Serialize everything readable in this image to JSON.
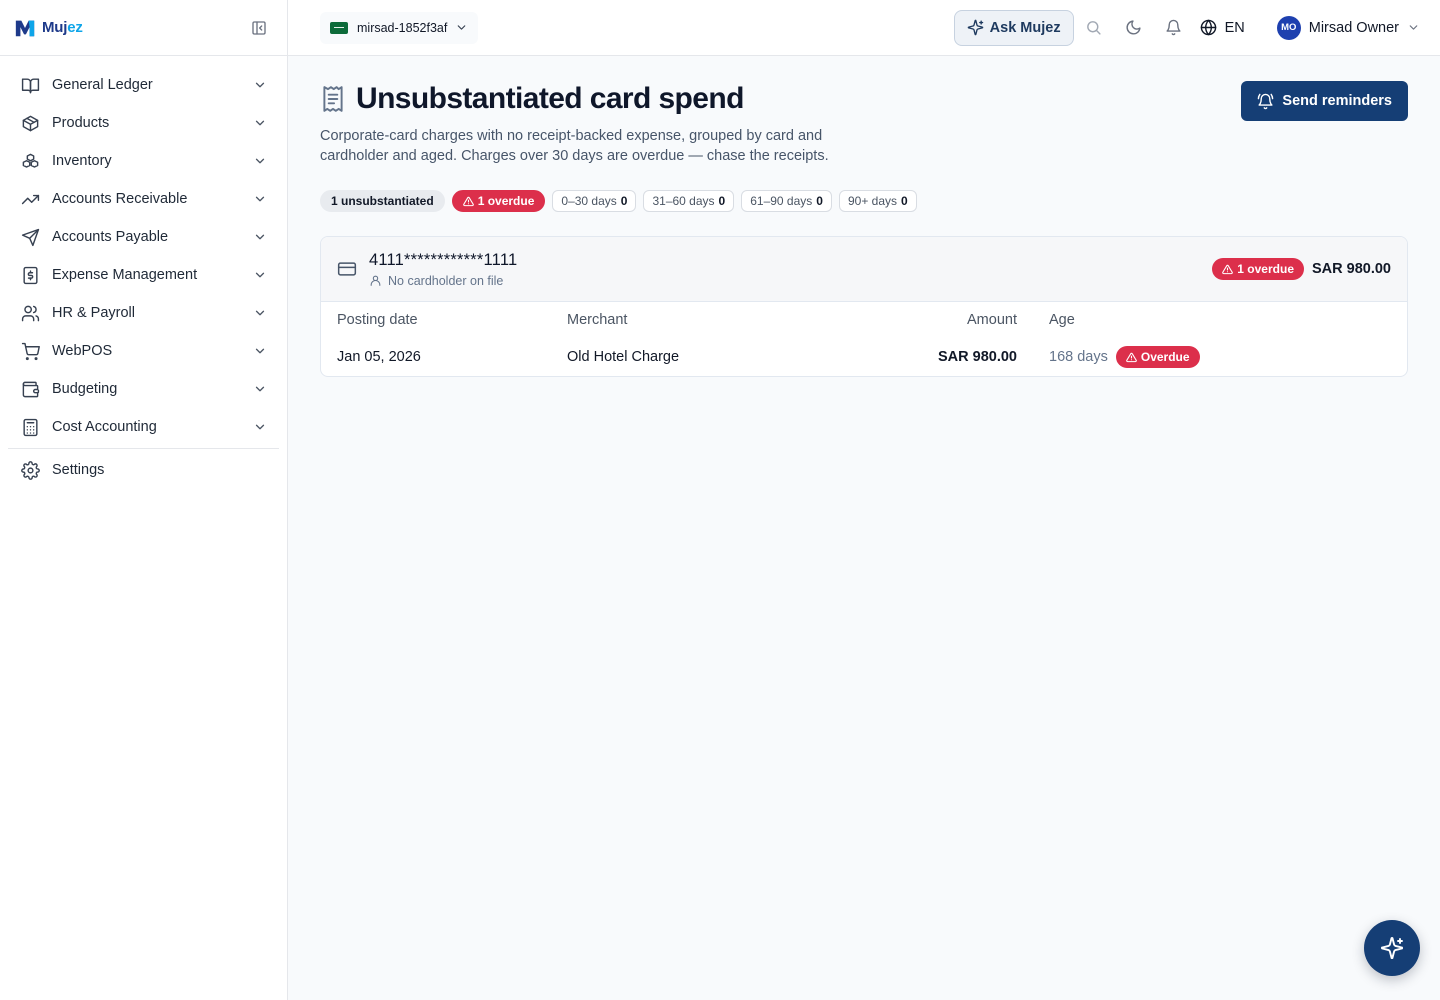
{
  "brand": {
    "name_main": "Muj",
    "name_accent": "ez"
  },
  "sidebar": {
    "items": [
      {
        "label": "General Ledger",
        "icon": "book-open-icon"
      },
      {
        "label": "Products",
        "icon": "box-icon"
      },
      {
        "label": "Inventory",
        "icon": "boxes-icon"
      },
      {
        "label": "Accounts Receivable",
        "icon": "trending-up-icon"
      },
      {
        "label": "Accounts Payable",
        "icon": "send-icon"
      },
      {
        "label": "Expense Management",
        "icon": "receipt-dollar-icon"
      },
      {
        "label": "HR & Payroll",
        "icon": "users-icon"
      },
      {
        "label": "WebPOS",
        "icon": "cart-icon"
      },
      {
        "label": "Budgeting",
        "icon": "wallet-icon"
      },
      {
        "label": "Cost Accounting",
        "icon": "calculator-icon"
      }
    ],
    "settings_label": "Settings"
  },
  "topbar": {
    "company": "mirsad-1852f3af",
    "ask_label": "Ask Mujez",
    "language": "EN",
    "user_initials": "MO",
    "user_name": "Mirsad Owner"
  },
  "page": {
    "title": "Unsubstantiated card spend",
    "subtitle": "Corporate-card charges with no receipt-backed expense, grouped by card and cardholder and aged. Charges over 30 days are overdue — chase the receipts.",
    "send_reminders_label": "Send reminders"
  },
  "summary": {
    "unsubstantiated": "1 unsubstantiated",
    "overdue": "1 overdue",
    "buckets": [
      {
        "label": "0–30 days",
        "count": "0"
      },
      {
        "label": "31–60 days",
        "count": "0"
      },
      {
        "label": "61–90 days",
        "count": "0"
      },
      {
        "label": "90+ days",
        "count": "0"
      }
    ]
  },
  "card_group": {
    "card_number": "4111************1111",
    "cardholder": "No cardholder on file",
    "overdue_badge": "1 overdue",
    "total": "SAR 980.00",
    "columns": {
      "posting_date": "Posting date",
      "merchant": "Merchant",
      "amount": "Amount",
      "age": "Age"
    },
    "rows": [
      {
        "posting_date": "Jan 05, 2026",
        "merchant": "Old Hotel Charge",
        "amount": "SAR 980.00",
        "age": "168 days",
        "status": "Overdue"
      }
    ]
  },
  "colors": {
    "primary": "#153e75",
    "danger": "#dc2f4b",
    "brand": "#1e3a8a",
    "brand_accent": "#0ea5e9"
  }
}
